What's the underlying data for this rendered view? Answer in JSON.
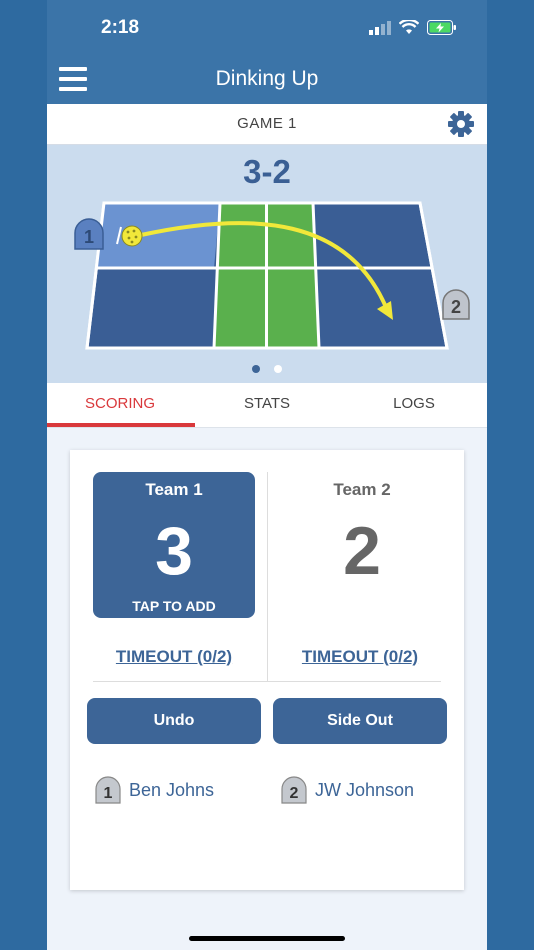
{
  "status": {
    "time": "2:18"
  },
  "nav": {
    "title": "Dinking Up",
    "menu_icon": "hamburger-menu-icon"
  },
  "game": {
    "title": "GAME 1",
    "settings_icon": "gear-icon"
  },
  "court": {
    "score": "3-2",
    "player_left_marker": "1",
    "player_right_marker": "2",
    "page_indicator": {
      "pages": 2,
      "active": 0
    }
  },
  "tabs": [
    {
      "label": "SCORING",
      "active": true
    },
    {
      "label": "STATS",
      "active": false
    },
    {
      "label": "LOGS",
      "active": false
    }
  ],
  "scoring": {
    "team1": {
      "name": "Team 1",
      "score": "3",
      "tap_label": "TAP TO ADD",
      "timeout": "TIMEOUT (0/2)"
    },
    "team2": {
      "name": "Team 2",
      "score": "2",
      "timeout": "TIMEOUT (0/2)"
    },
    "undo_label": "Undo",
    "side_out_label": "Side Out",
    "players": [
      {
        "marker": "1",
        "name": "Ben Johns"
      },
      {
        "marker": "2",
        "name": "JW Johnson"
      }
    ]
  },
  "colors": {
    "accent": "#3d6597",
    "header": "#3b74a8",
    "active_tab": "#d9383b",
    "court_blue": "#3a5e95",
    "kitchen_green": "#5ab04d",
    "ball_path": "#f1e83a"
  }
}
